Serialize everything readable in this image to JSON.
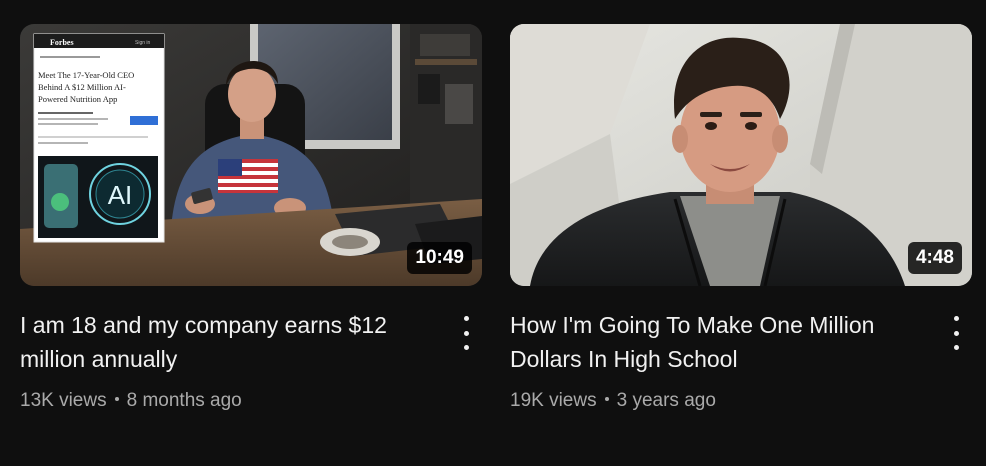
{
  "videos": [
    {
      "title": "I am 18 and my company earns $12 million annually",
      "views": "13K views",
      "age": "8 months ago",
      "duration": "10:49",
      "thumbnail": {
        "article_brand": "Forbes",
        "article_headline_1": "Meet The 17-Year-Old CEO",
        "article_headline_2": "Behind A $12 Million AI-",
        "article_headline_3": "Powered Nutrition App",
        "logo_text": "AI"
      }
    },
    {
      "title": "How I'm Going To Make One Million Dollars In High School",
      "views": "19K views",
      "age": "3 years ago",
      "duration": "4:48"
    }
  ],
  "icons": {
    "more": "more-vert-icon"
  },
  "colors": {
    "background": "#0f0f0f",
    "title_text": "#f1f1f1",
    "secondary_text": "#aaaaaa",
    "duration_badge": "#000000"
  }
}
